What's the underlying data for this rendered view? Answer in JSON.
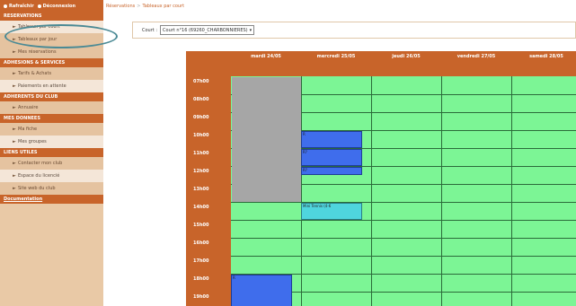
{
  "sidebar": {
    "top_links": [
      "Rafraîchir",
      "Déconnexion"
    ],
    "sections": [
      {
        "header": "RESERVATIONS",
        "items": [
          {
            "label": "Tableaux par court",
            "style": "light"
          },
          {
            "label": "Tableaux par jour",
            "style": "normal"
          },
          {
            "label": "Mes réservations",
            "style": "normal"
          }
        ]
      },
      {
        "header": "ADHESIONS & SERVICES",
        "items": [
          {
            "label": "Tarifs & Achats",
            "style": "normal"
          },
          {
            "label": "Paiements en attente",
            "style": "light"
          }
        ]
      },
      {
        "header": "ADHERENTS DU CLUB",
        "items": [
          {
            "label": "Annuaire",
            "style": "normal"
          }
        ]
      },
      {
        "header": "MES DONNEES",
        "items": [
          {
            "label": "Ma fiche",
            "style": "normal"
          },
          {
            "label": "Mes groupes",
            "style": "light"
          }
        ]
      },
      {
        "header": "LIENS UTILES",
        "items": [
          {
            "label": "Contacter mon club",
            "style": "normal"
          },
          {
            "label": "Espace du licencié",
            "style": "light"
          },
          {
            "label": "Site web du club",
            "style": "normal"
          }
        ]
      }
    ],
    "doc_link": "Documentation"
  },
  "breadcrumb": [
    "Réservations",
    "Tableaux par court"
  ],
  "court_selector": {
    "label": "Court :",
    "value": "Court n°16 (69260_CHARBONNIERES)"
  },
  "schedule": {
    "days": [
      "mardi 24/05",
      "mercredi 25/05",
      "jeudi 26/05",
      "vendredi 27/05",
      "samedi 28/05"
    ],
    "times": [
      "07h00",
      "08h00",
      "09h00",
      "10h00",
      "11h00",
      "12h00",
      "13h00",
      "14h00",
      "15h00",
      "16h00",
      "17h00",
      "18h00",
      "19h00"
    ],
    "bookings": [
      {
        "day": 0,
        "start": 0,
        "end": 7,
        "type": "gray",
        "label": ""
      },
      {
        "day": 1,
        "start": 3,
        "end": 4,
        "type": "blue",
        "label": "R"
      },
      {
        "day": 1,
        "start": 4,
        "end": 5,
        "type": "blue",
        "label": "R?"
      },
      {
        "day": 1,
        "start": 5,
        "end": 5.5,
        "type": "blue",
        "label": "R?"
      },
      {
        "day": 1,
        "start": 7,
        "end": 8,
        "type": "cyan",
        "label": "Mini Tennis (4-6"
      },
      {
        "day": 0,
        "start": 11,
        "end": 13,
        "type": "blue",
        "label": "R"
      }
    ]
  },
  "colors": {
    "brand": "#c8642a",
    "free": "#7cf595",
    "reserved": "#3f6dec",
    "school": "#4fd5de",
    "blocked": "#a6a6a6"
  }
}
